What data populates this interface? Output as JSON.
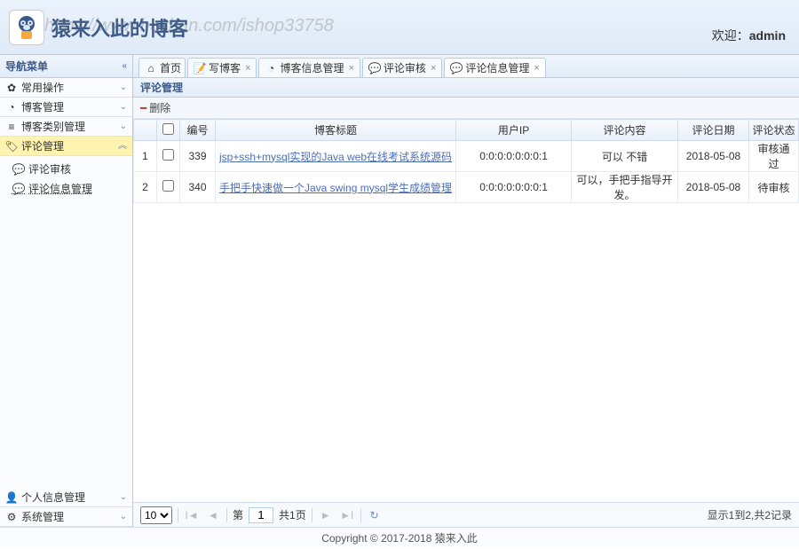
{
  "header": {
    "site_title": "猿来入此的博客",
    "watermark": "https://www.huzhan.com/ishop33758",
    "welcome_prefix": "欢迎：",
    "welcome_user": "admin"
  },
  "sidebar": {
    "title": "导航菜单",
    "items": [
      {
        "icon": "star",
        "label": "常用操作",
        "chev": "⌄"
      },
      {
        "icon": "clock",
        "label": "博客管理",
        "chev": "⌄"
      },
      {
        "icon": "list",
        "label": "博客类别管理",
        "chev": "⌄"
      },
      {
        "icon": "tag",
        "label": "评论管理",
        "chev": "︽",
        "active": true
      }
    ],
    "subs": [
      {
        "icon": "chat",
        "label": "评论审核"
      },
      {
        "icon": "chat",
        "label": "评论信息管理",
        "underline": true
      }
    ],
    "bottom": [
      {
        "icon": "user",
        "label": "个人信息管理",
        "chev": "⌄"
      },
      {
        "icon": "gear",
        "label": "系统管理",
        "chev": "⌄"
      }
    ]
  },
  "tabs": [
    {
      "icon": "home",
      "label": "首页",
      "closable": false
    },
    {
      "icon": "doc",
      "label": "写博客",
      "closable": true
    },
    {
      "icon": "clock",
      "label": "博客信息管理",
      "closable": true
    },
    {
      "icon": "chat",
      "label": "评论审核",
      "closable": true
    },
    {
      "icon": "chat",
      "label": "评论信息管理",
      "closable": true,
      "active": true
    }
  ],
  "panel": {
    "title": "评论管理",
    "delete_label": "删除",
    "columns": [
      "",
      "",
      "编号",
      "博客标题",
      "用户IP",
      "评论内容",
      "评论日期",
      "评论状态"
    ],
    "rows": [
      {
        "n": "1",
        "id": "339",
        "title": "jsp+ssh+mysql实现的Java web在线考试系统源码",
        "ip": "0:0:0:0:0:0:0:1",
        "content": "可以 不错",
        "date": "2018-05-08",
        "status": "审核通过"
      },
      {
        "n": "2",
        "id": "340",
        "title": "手把手快速做一个Java swing mysql学生成绩管理",
        "ip": "0:0:0:0:0:0:0:1",
        "content": "可以，手把手指导开发。",
        "date": "2018-05-08",
        "status": "待审核"
      }
    ]
  },
  "pager": {
    "page_size": "10",
    "prefix": "第",
    "current": "1",
    "suffix": "共1页",
    "info": "显示1到2,共2记录"
  },
  "footer": "Copyright © 2017-2018 猿来入此"
}
